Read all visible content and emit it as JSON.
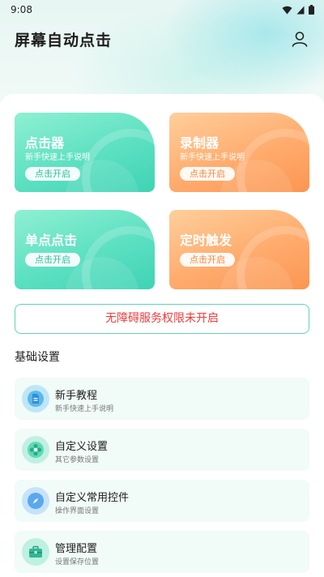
{
  "status_bar": {
    "time": "9:08"
  },
  "header": {
    "title": "屏幕自动点击"
  },
  "cards": [
    {
      "title": "点击器",
      "subtitle": "新手快速上手说明",
      "button": "点击开启"
    },
    {
      "title": "录制器",
      "subtitle": "新手快速上手说明",
      "button": "点击开启"
    },
    {
      "title": "单点点击",
      "button": "点击开启"
    },
    {
      "title": "定时触发",
      "button": "点击开启"
    }
  ],
  "warning_button": "无障碍服务权限未开启",
  "section_title": "基础设置",
  "settings": [
    {
      "title": "新手教程",
      "subtitle": "新手快速上手说明",
      "icon": "document-icon"
    },
    {
      "title": "自定义设置",
      "subtitle": "其它参数设置",
      "icon": "flower-gear-icon"
    },
    {
      "title": "自定义常用控件",
      "subtitle": "操作界面设置",
      "icon": "compass-icon"
    },
    {
      "title": "管理配置",
      "subtitle": "设置保存位置",
      "icon": "briefcase-icon"
    }
  ],
  "colors": {
    "teal": "#4fd9bb",
    "orange": "#fb9a58",
    "warning_text": "#ee3b3b",
    "list_bg": "#f1fbf8"
  }
}
